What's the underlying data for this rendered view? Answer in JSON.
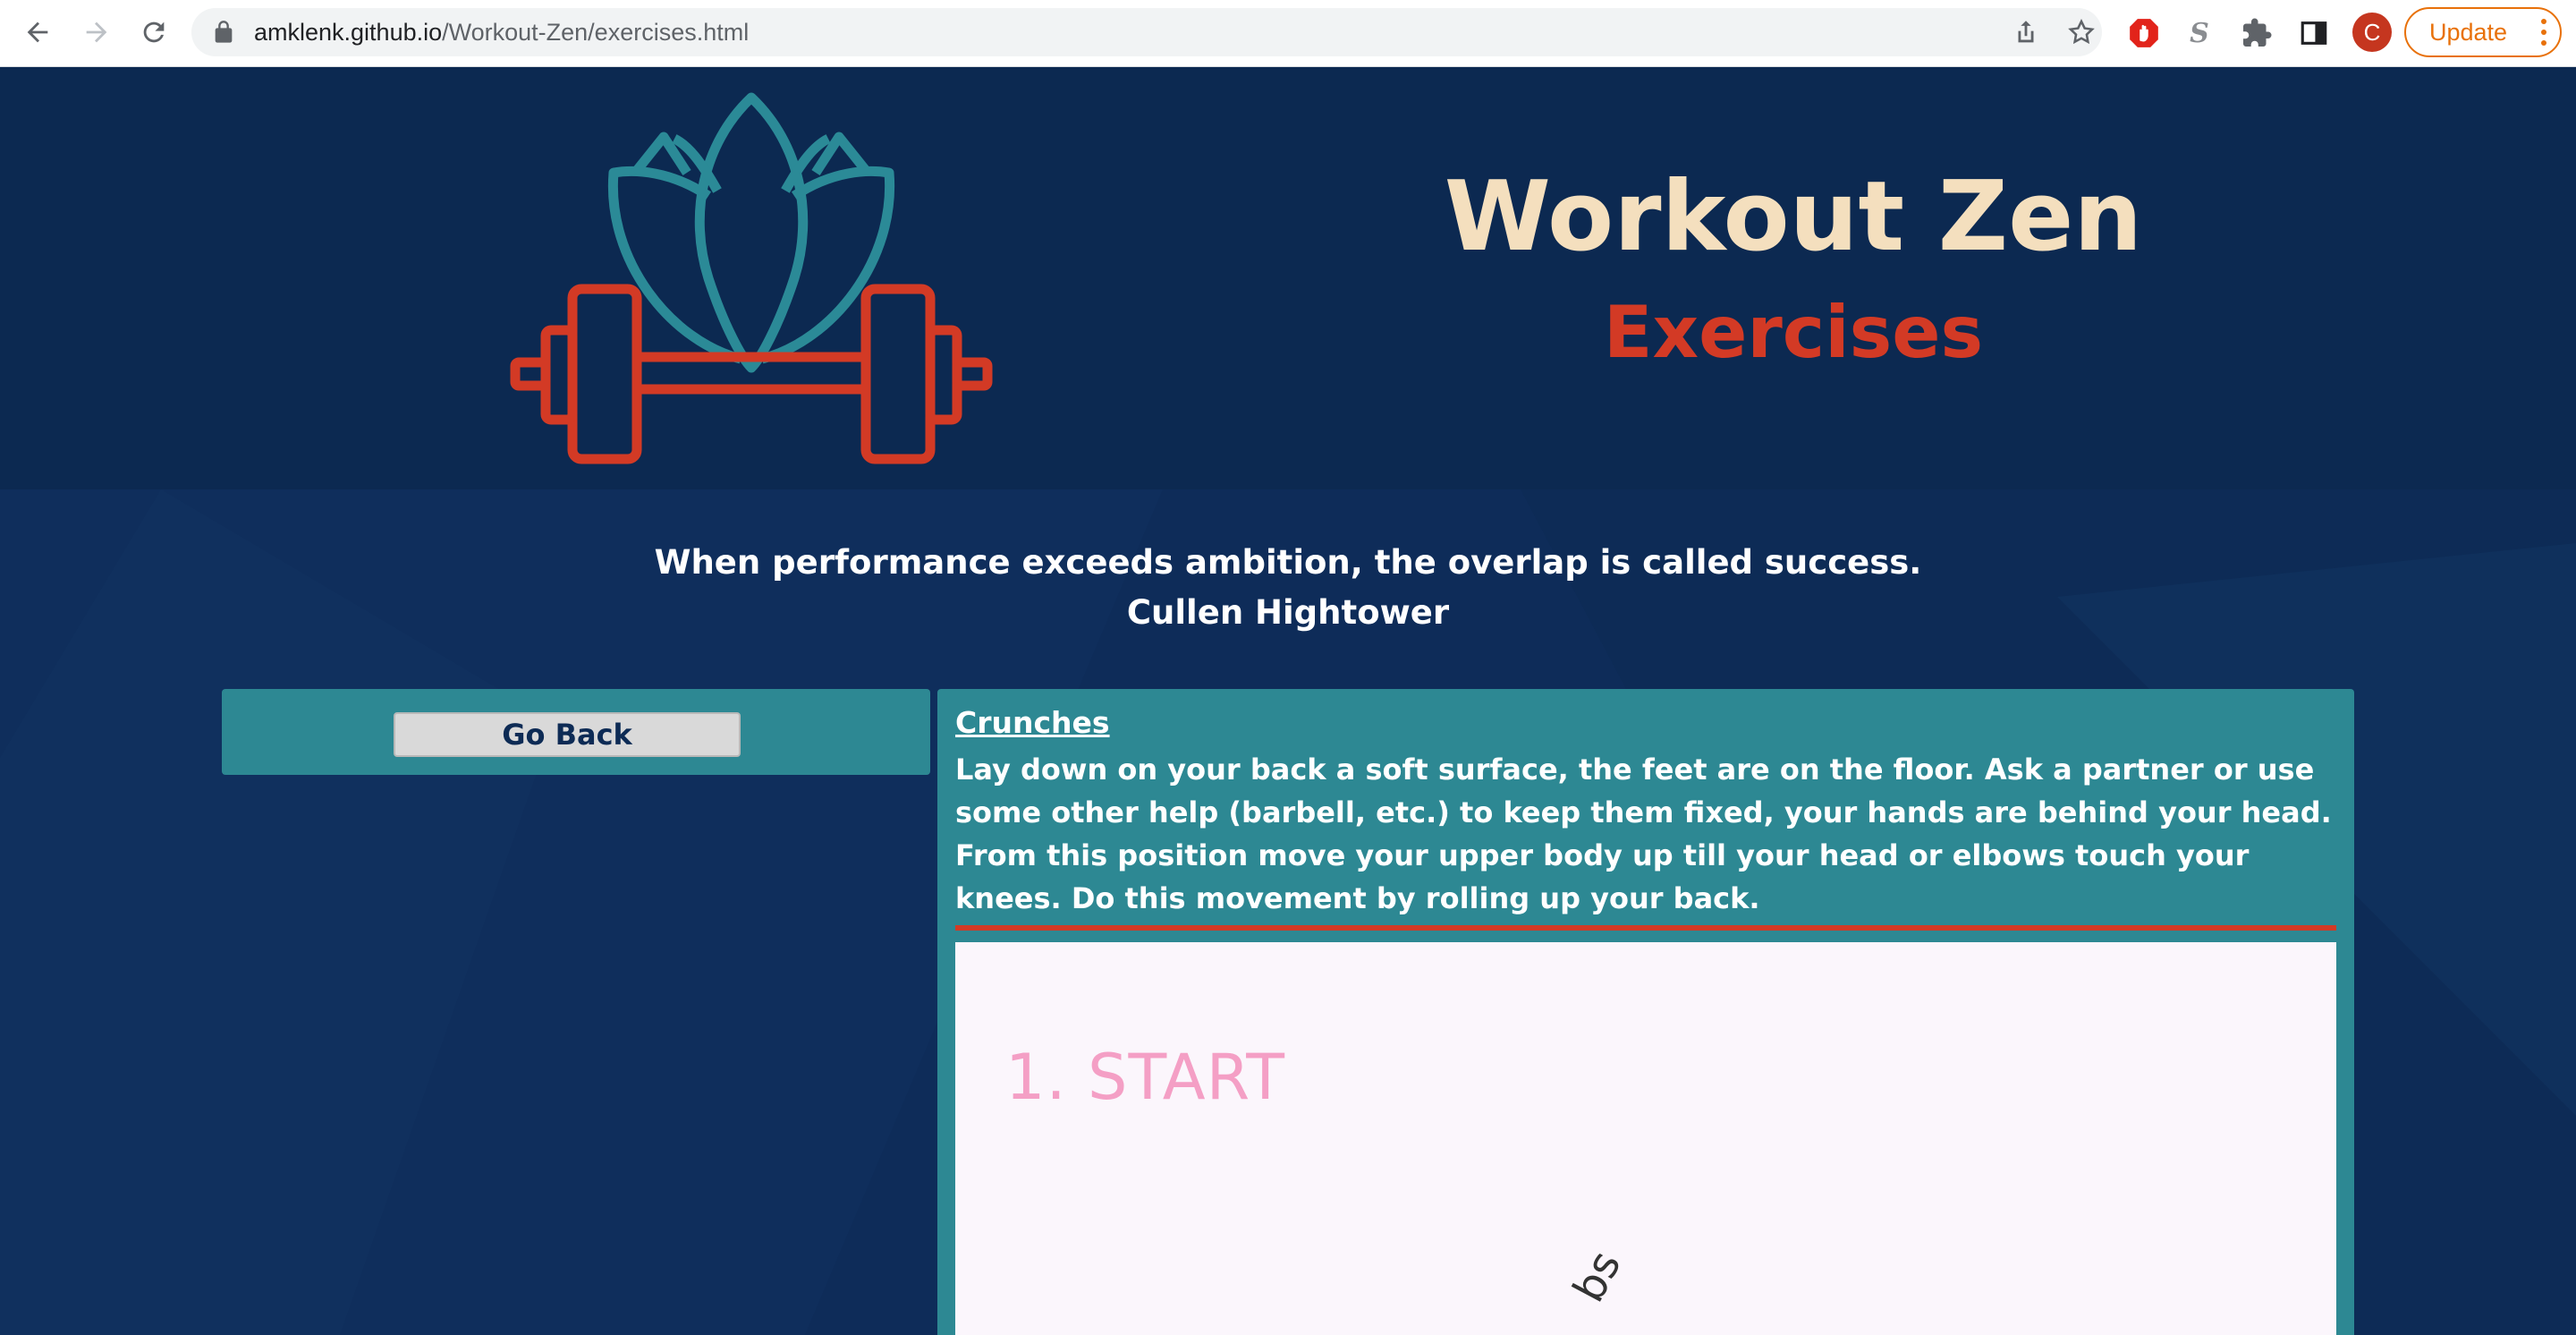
{
  "browser": {
    "url_host": "amklenk.github.io",
    "url_path": "/Workout-Zen/exercises.html",
    "avatar_letter": "C",
    "update_label": "Update",
    "icons": [
      "back-arrow-icon",
      "forward-arrow-icon",
      "reload-icon",
      "lock-icon",
      "share-icon",
      "star-icon",
      "adblock-icon",
      "s-extension-icon",
      "puzzle-extensions-icon",
      "side-panel-icon",
      "more-vert-icon"
    ]
  },
  "header": {
    "title": "Workout Zen",
    "subtitle": "Exercises",
    "colors": {
      "title": "#f4dfbe",
      "subtitle": "#d33a25",
      "logo_lotus": "#2b8a97",
      "logo_barbell": "#d33a25"
    }
  },
  "quote": {
    "text": "When performance exceeds ambition, the overlap is called success.",
    "author": "Cullen Hightower"
  },
  "sidebar": {
    "go_back_label": "Go Back"
  },
  "exercise": {
    "name": "Crunches",
    "description": "Lay down on your back a soft surface, the feet are on the floor. Ask a partner or use some other help (barbell, etc.) to keep them fixed, your hands are behind your head. From this position move your upper body up till your head or elbows touch your knees. Do this movement by rolling up your back.",
    "image": {
      "caption": "1. START",
      "partial_label": "bs"
    },
    "colors": {
      "panel": "#2d8893",
      "rule": "#d33a25"
    }
  }
}
